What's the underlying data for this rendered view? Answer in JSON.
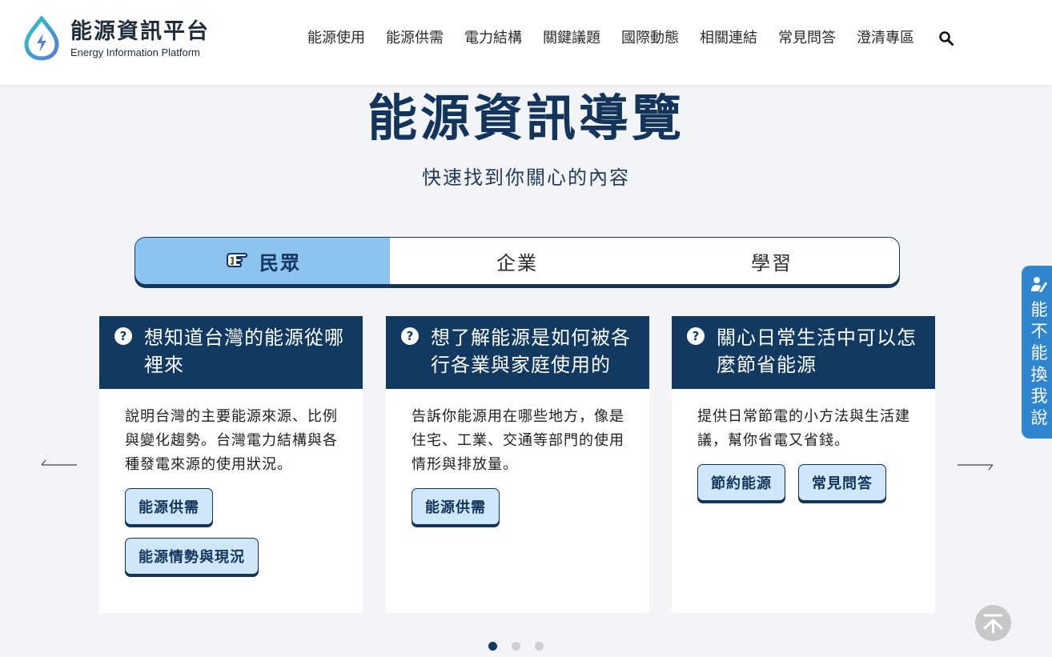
{
  "header": {
    "logo_title": "能源資訊平台",
    "logo_subtitle": "Energy Information Platform",
    "nav": [
      {
        "label": "能源使用"
      },
      {
        "label": "能源供需"
      },
      {
        "label": "電力結構"
      },
      {
        "label": "關鍵議題"
      },
      {
        "label": "國際動態"
      },
      {
        "label": "相關連結"
      },
      {
        "label": "常見問答"
      },
      {
        "label": "澄清專區"
      }
    ],
    "search_icon": "search-icon"
  },
  "hero": {
    "title": "能源資訊導覽",
    "subtitle": "快速找到你關心的內容"
  },
  "tabs": [
    {
      "label": "民眾",
      "active": true,
      "icon": "pointing-hand-icon"
    },
    {
      "label": "企業",
      "active": false
    },
    {
      "label": "學習",
      "active": false
    }
  ],
  "cards": [
    {
      "title": "想知道台灣的能源從哪裡來",
      "description": "說明台灣的主要能源來源、比例與變化趨勢。台灣電力結構與各種發電來源的使用狀況。",
      "buttons": [
        "能源供需",
        "能源情勢與現況"
      ]
    },
    {
      "title": "想了解能源是如何被各行各業與家庭使用的",
      "description": "告訴你能源用在哪些地方，像是住宅、工業、交通等部門的使用情形與排放量。",
      "buttons": [
        "能源供需"
      ]
    },
    {
      "title": "關心日常生活中可以怎麼節省能源",
      "description": "提供日常節電的小方法與生活建議，幫你省電又省錢。",
      "buttons": [
        "節約能源",
        "常見問答"
      ]
    }
  ],
  "carousel": {
    "dots": 3,
    "active_dot": 1
  },
  "side_tab": {
    "label": "能不能換我說",
    "icon": "feedback-icon"
  },
  "colors": {
    "primary_navy": "#123a60",
    "tab_active": "#8cc3ef",
    "pill_bg": "#cfe6fb",
    "side_tab": "#2f86cf"
  }
}
